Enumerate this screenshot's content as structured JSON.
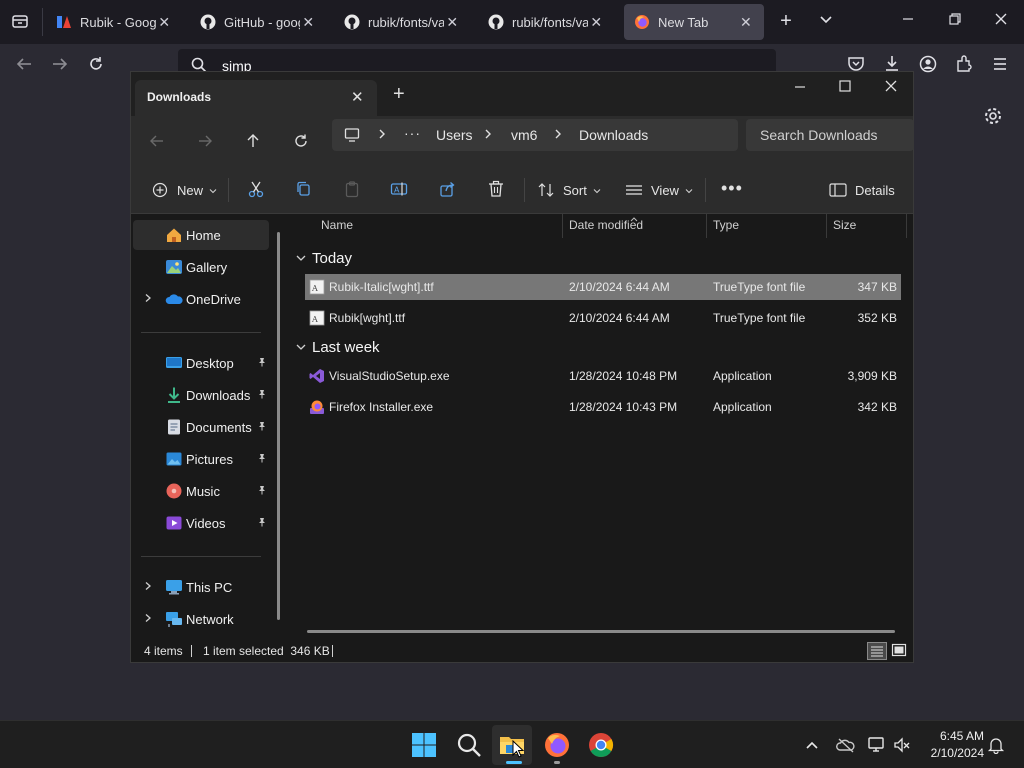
{
  "browser": {
    "tabs": [
      {
        "label": "Rubik - Google F",
        "icon": "google-fonts-icon"
      },
      {
        "label": "GitHub - google",
        "icon": "github-icon"
      },
      {
        "label": "rubik/fonts/vari",
        "icon": "github-icon"
      },
      {
        "label": "rubik/fonts/vari",
        "icon": "github-icon"
      },
      {
        "label": "New Tab",
        "icon": "firefox-icon"
      }
    ],
    "url_text": "simp"
  },
  "explorer": {
    "tab_title": "Downloads",
    "breadcrumb": [
      "Users",
      "vm6",
      "Downloads"
    ],
    "breadcrumb_more": "···",
    "search_placeholder": "Search Downloads",
    "toolbar": {
      "new_label": "New",
      "sort_label": "Sort",
      "view_label": "View",
      "details_label": "Details"
    },
    "nav": {
      "items_top": [
        {
          "label": "Home",
          "icon": "home-icon",
          "selected": true
        },
        {
          "label": "Gallery",
          "icon": "gallery-icon"
        },
        {
          "label": "OneDrive",
          "icon": "onedrive-icon",
          "expandable": true
        }
      ],
      "quick_access": [
        {
          "label": "Desktop",
          "icon": "desktop-icon"
        },
        {
          "label": "Downloads",
          "icon": "downloads-icon"
        },
        {
          "label": "Documents",
          "icon": "documents-icon"
        },
        {
          "label": "Pictures",
          "icon": "pictures-icon"
        },
        {
          "label": "Music",
          "icon": "music-icon"
        },
        {
          "label": "Videos",
          "icon": "videos-icon"
        }
      ],
      "items_bottom": [
        {
          "label": "This PC",
          "icon": "this-pc-icon"
        },
        {
          "label": "Network",
          "icon": "network-icon"
        }
      ]
    },
    "columns": [
      "Name",
      "Date modified",
      "Type",
      "Size"
    ],
    "groups": [
      {
        "label": "Today",
        "files": [
          {
            "name": "Rubik-Italic[wght].ttf",
            "date": "2/10/2024 6:44 AM",
            "type": "TrueType font file",
            "size": "347 KB",
            "icon": "font-file-icon",
            "selected": true
          },
          {
            "name": "Rubik[wght].ttf",
            "date": "2/10/2024 6:44 AM",
            "type": "TrueType font file",
            "size": "352 KB",
            "icon": "font-file-icon"
          }
        ]
      },
      {
        "label": "Last week",
        "files": [
          {
            "name": "VisualStudioSetup.exe",
            "date": "1/28/2024 10:48 PM",
            "type": "Application",
            "size": "3,909 KB",
            "icon": "visual-studio-icon"
          },
          {
            "name": "Firefox Installer.exe",
            "date": "1/28/2024 10:43 PM",
            "type": "Application",
            "size": "342 KB",
            "icon": "firefox-installer-icon"
          }
        ]
      }
    ],
    "status": {
      "items": "4 items",
      "selection": "1 item selected  346 KB"
    }
  },
  "taskbar": {
    "time": "6:45 AM",
    "date": "2/10/2024"
  },
  "colors": {
    "accent": "#0078d4",
    "selected_row": "#777777"
  }
}
